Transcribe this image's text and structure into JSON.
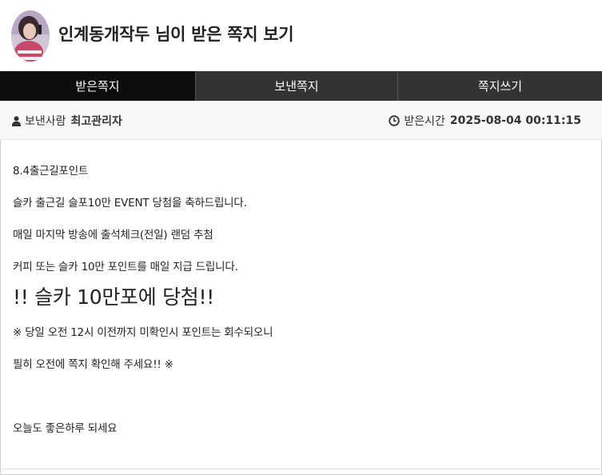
{
  "header": {
    "title": "인계동개작두 님이 받은 쪽지 보기",
    "avatar_icon": "user-avatar-photo"
  },
  "tabs": [
    {
      "label": "받은쪽지",
      "active": true
    },
    {
      "label": "보낸쪽지",
      "active": false
    },
    {
      "label": "쪽지쓰기",
      "active": false
    }
  ],
  "meta": {
    "sender_label": "보낸사람",
    "sender_name": "최고관리자",
    "sender_icon": "user-icon",
    "received_label": "받은시간",
    "received_time": "2025-08-04 00:11:15",
    "received_icon": "clock-icon"
  },
  "message": {
    "line1": "8.4출근길포인트",
    "line2": "슬카 출근길 슬포10만 EVENT 당첨을 축하드립니다.",
    "line3": "매일 마지막 방송에 출석체크(전일) 랜덤 추첨",
    "line4": "커피 또는 슬카 10만 포인트를 매일 지급 드립니다.",
    "headline": "!! 슬카 10만포에 당첨!!",
    "line6": "※ 당일 오전 12시 이전까지 미확인시 포인트는 회수되오니",
    "line7": "필히 오전에 쪽지 확인해 주세요!! ※",
    "line8": "오늘도 좋은하루 되세요"
  },
  "colors": {
    "tab_bg": "#333333",
    "tab_active_bg": "#0d0d0d",
    "meta_bg": "#f7f7f7"
  }
}
